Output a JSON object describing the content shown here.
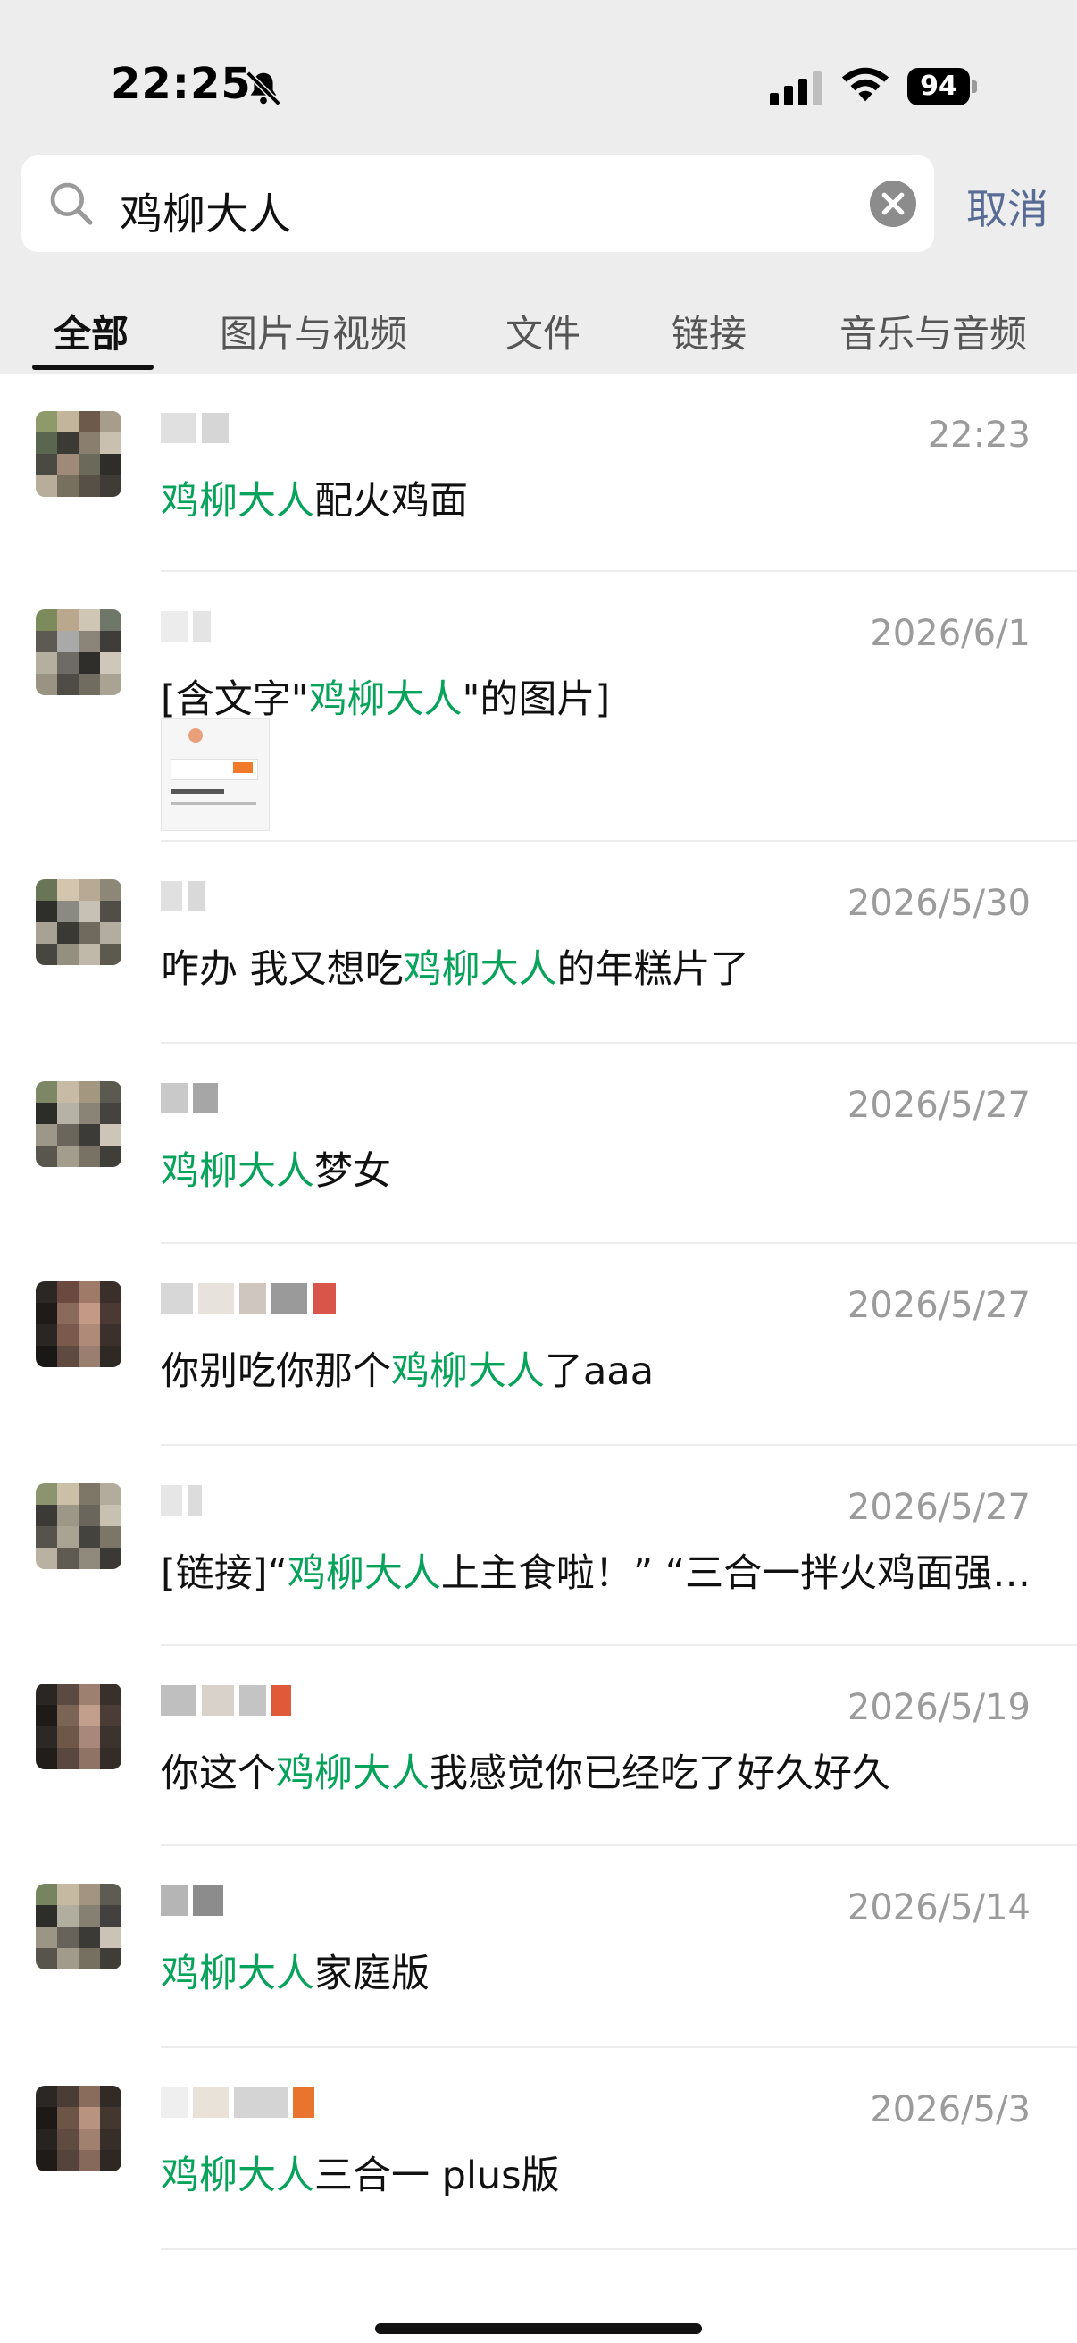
{
  "status_bar": {
    "time": "22:25",
    "battery": "94",
    "icons": [
      "bell-slash-icon",
      "cellular-signal-icon",
      "wifi-icon",
      "battery-icon"
    ]
  },
  "search": {
    "query": "鸡柳大人",
    "cancel_label": "取消",
    "icons": [
      "search-icon",
      "clear-icon"
    ]
  },
  "tabs": [
    {
      "label": "全部",
      "active": true
    },
    {
      "label": "图片与视频",
      "active": false
    },
    {
      "label": "文件",
      "active": false
    },
    {
      "label": "链接",
      "active": false
    },
    {
      "label": "音乐与音频",
      "active": false
    }
  ],
  "colors": {
    "highlight": "#07a35a",
    "cancel": "#576b95",
    "timestamp": "#9b9b9b",
    "header_bg": "#ededed"
  },
  "results": [
    {
      "time": "22:23",
      "message": {
        "before": "",
        "highlight": "鸡柳大人",
        "after": "配火鸡面"
      }
    },
    {
      "time": "2026/6/1",
      "message": {
        "before": "[含文字\"",
        "highlight": "鸡柳大人",
        "after": "\"的图片]"
      },
      "has_thumbnail": true
    },
    {
      "time": "2026/5/30",
      "message": {
        "before": "咋办 我又想吃",
        "highlight": "鸡柳大人",
        "after": "的年糕片了"
      }
    },
    {
      "time": "2026/5/27",
      "message": {
        "before": "",
        "highlight": "鸡柳大人",
        "after": "梦女"
      }
    },
    {
      "time": "2026/5/27",
      "message": {
        "before": "你别吃你那个",
        "highlight": "鸡柳大人",
        "after": "了aaa"
      }
    },
    {
      "time": "2026/5/27",
      "message": {
        "before": "[链接]“",
        "highlight": "鸡柳大人",
        "after": "上主食啦！” “三合一拌火鸡面强…"
      }
    },
    {
      "time": "2026/5/19",
      "message": {
        "before": "你这个",
        "highlight": "鸡柳大人",
        "after": "我感觉你已经吃了好久好久"
      }
    },
    {
      "time": "2026/5/14",
      "message": {
        "before": "",
        "highlight": "鸡柳大人",
        "after": "家庭版"
      }
    },
    {
      "time": "2026/5/3",
      "message": {
        "before": "",
        "highlight": "鸡柳大人",
        "after": "三合一 plus版"
      }
    }
  ]
}
